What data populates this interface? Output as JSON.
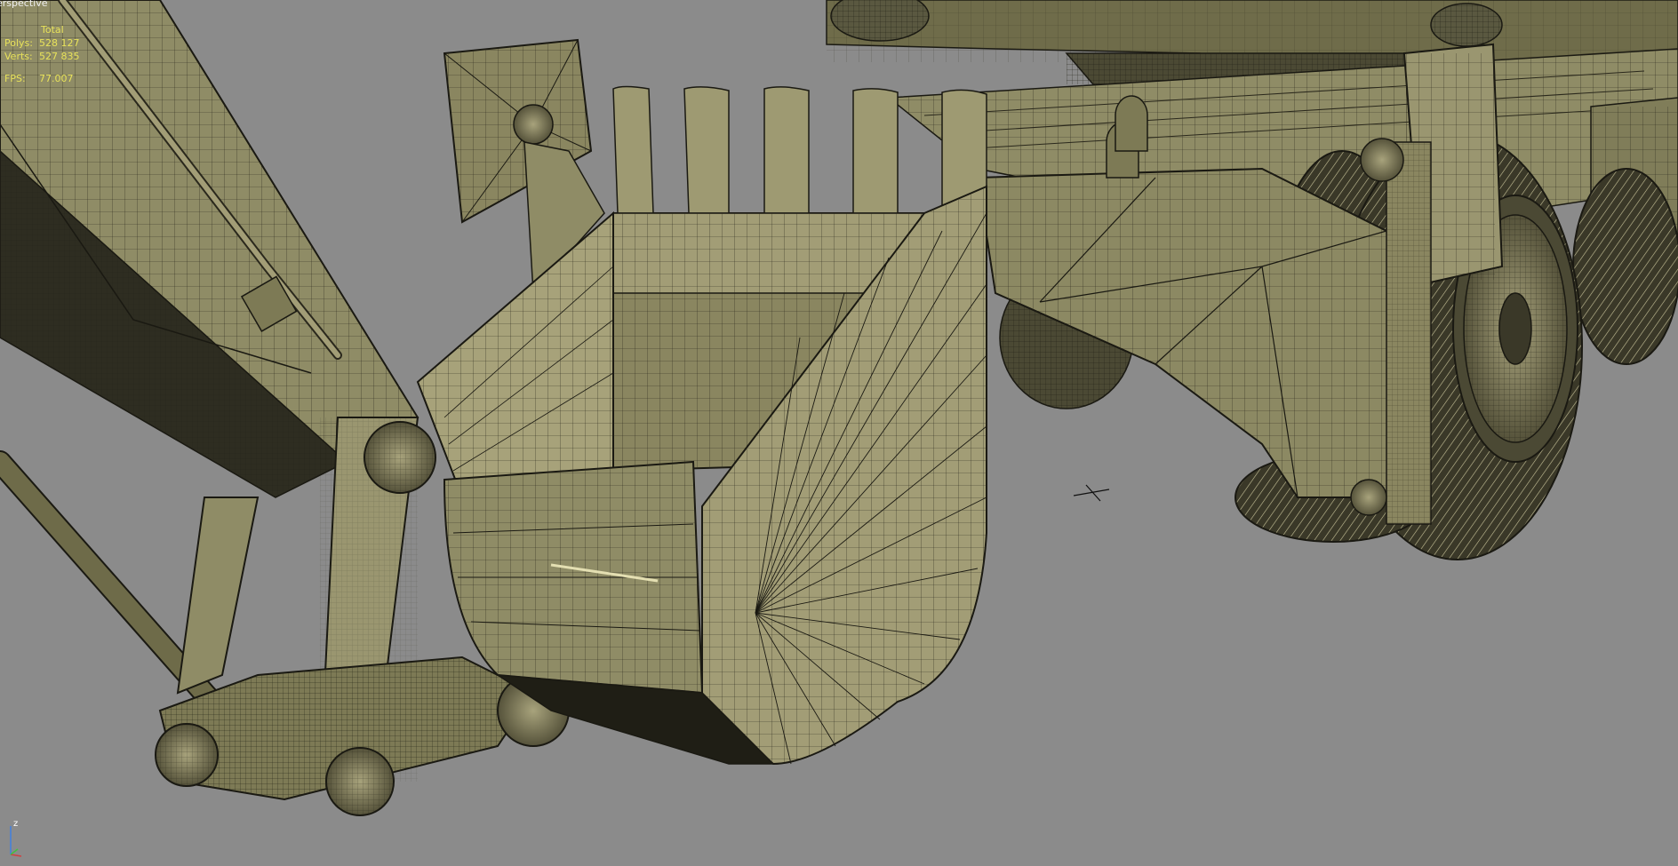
{
  "viewport": {
    "label": "erspective",
    "background": "#8b8b8b",
    "model_fill": "#7d7a55",
    "model_light": "#a7a27a",
    "model_dark": "#24231a",
    "wire_color": "#1a1912"
  },
  "stats": {
    "total_label": "Total",
    "polys_label": "Polys:",
    "polys_value": "528 127",
    "verts_label": "Verts:",
    "verts_value": "527 835",
    "fps_label": "FPS:",
    "fps_value": "77.007",
    "text_color": "#e8e25a"
  },
  "axis": {
    "z_label": "z",
    "colors": {
      "x": "#d04040",
      "y": "#40c040",
      "z": "#4080e0"
    }
  },
  "cursor": {
    "icon": "crosshair-cursor-icon"
  }
}
